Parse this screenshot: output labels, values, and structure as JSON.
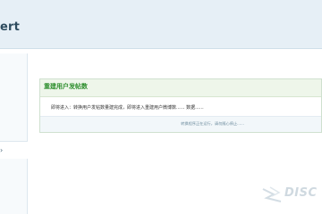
{
  "header": {
    "title": "ert"
  },
  "sidebar": {
    "arrow": "›"
  },
  "message": {
    "title": "重建用户发帖数",
    "body": "即将进入：转换用户发帖数量建完成，即将进入重建用户微博数...... 数据......",
    "footer": "转换程序正在运行，请勿随心停止......"
  },
  "watermark": {
    "text": "DISC"
  }
}
